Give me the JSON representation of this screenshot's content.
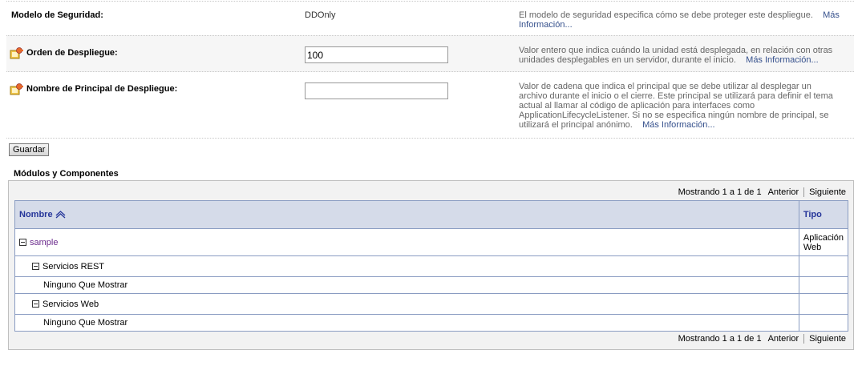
{
  "form": {
    "security_model": {
      "label": "Modelo de Seguridad:",
      "value": "DDOnly",
      "help": "El modelo de seguridad especifica cómo se debe proteger este despliegue.",
      "more": "Más Información..."
    },
    "deployment_order": {
      "label": "Orden de Despliegue:",
      "value": "100",
      "help": "Valor entero que indica cuándo la unidad está desplegada, en relación con otras unidades desplegables en un servidor, durante el inicio.",
      "more": "Más Información..."
    },
    "deployment_principal": {
      "label": "Nombre de Principal de Despliegue:",
      "value": "",
      "help": "Valor de cadena que indica el principal que se debe utilizar al desplegar un archivo durante el inicio o el cierre. Este principal se utilizará para definir el tema actual al llamar al código de aplicación para interfaces como ApplicationLifecycleListener. Si no se especifica ningún nombre de principal, se utilizará el principal anónimo.",
      "more": "Más Información..."
    },
    "save_label": "Guardar"
  },
  "modules": {
    "title": "Módulos y Componentes",
    "pager": {
      "showing": "Mostrando 1 a 1 de 1",
      "prev": "Anterior",
      "next": "Siguiente"
    },
    "columns": {
      "name": "Nombre",
      "type": "Tipo"
    },
    "rows": [
      {
        "name": "sample",
        "type": "Aplicación Web"
      },
      {
        "name": "Servicios REST",
        "type": ""
      },
      {
        "name": "Ninguno Que Mostrar",
        "type": ""
      },
      {
        "name": "Servicios Web",
        "type": ""
      },
      {
        "name": "Ninguno Que Mostrar",
        "type": ""
      }
    ]
  }
}
